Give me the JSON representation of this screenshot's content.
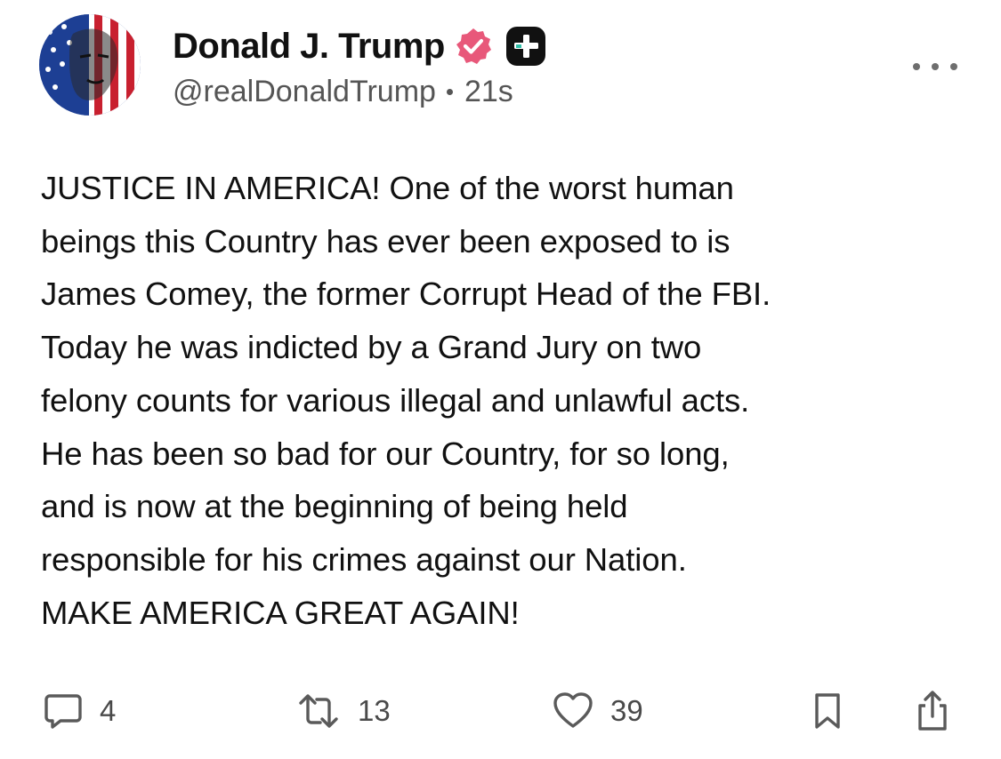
{
  "author": {
    "display_name": "Donald J. Trump",
    "handle": "@realDonaldTrump",
    "timestamp": "21s",
    "verified_color": "#e8587a",
    "badge_color": "#111111"
  },
  "post": {
    "text": "JUSTICE IN AMERICA! One of the worst human\nbeings this Country has ever been exposed to is\nJames Comey, the former Corrupt Head of the FBI.\nToday he was indicted by a Grand Jury on two\nfelony counts for various illegal and unlawful acts.\nHe has been so bad for our Country, for so long,\nand is now at the beginning of being held\nresponsible for his crimes against our Nation.\nMAKE AMERICA GREAT AGAIN!"
  },
  "actions": {
    "replies": "4",
    "reposts": "13",
    "likes": "39"
  },
  "icons": {
    "avatar": "avatar-american-flag-portrait",
    "verified": "verified-badge-icon",
    "plus": "plus-badge-icon",
    "more": "more-dots-icon",
    "reply": "speech-bubble-icon",
    "repost": "repost-arrows-icon",
    "like": "heart-icon",
    "bookmark": "bookmark-icon",
    "share": "share-icon"
  }
}
